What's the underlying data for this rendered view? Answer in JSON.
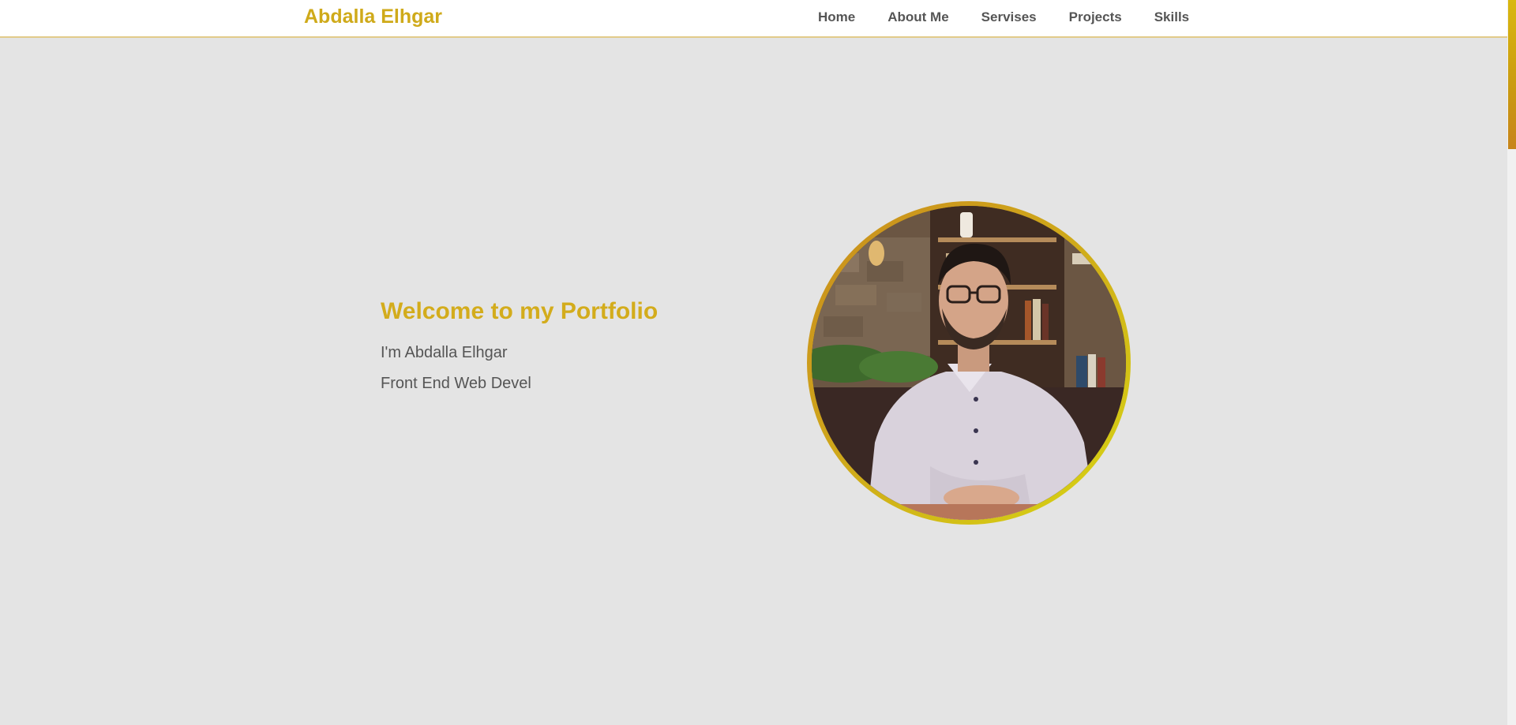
{
  "header": {
    "brand": "Abdalla Elhgar",
    "nav": [
      {
        "label": "Home"
      },
      {
        "label": "About Me"
      },
      {
        "label": "Servises"
      },
      {
        "label": "Projects"
      },
      {
        "label": "Skills"
      }
    ]
  },
  "hero": {
    "title": "Welcome to my Portfolio",
    "intro": "I'm Abdalla Elhgar",
    "role": "Front End Web Devel"
  },
  "profile_image": {
    "icon": "profile-photo"
  },
  "colors": {
    "accent": "#d3ac1c",
    "text": "#555555",
    "background": "#e4e4e4",
    "navbar": "#ffffff"
  }
}
